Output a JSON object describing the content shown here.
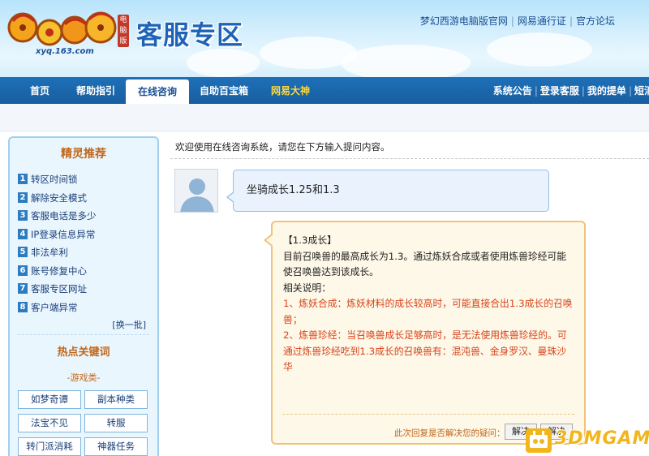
{
  "header": {
    "logo_url": "xyq.163.com",
    "logo_badge": "电脑版",
    "zone_title": "客服专区",
    "top_links": [
      "梦幻西游电脑版官网",
      "网易通行证",
      "官方论坛"
    ]
  },
  "nav": {
    "items": [
      "首页",
      "帮助指引",
      "在线咨询",
      "自助百宝箱",
      "网易大神"
    ],
    "active_index": 2,
    "right_links": [
      "系统公告",
      "登录客服",
      "我的提单",
      "短消"
    ]
  },
  "sidebar": {
    "title": "精灵推荐",
    "items": [
      "转区时间锁",
      "解除安全模式",
      "客服电话是多少",
      "IP登录信息异常",
      "非法牟利",
      "账号修复中心",
      "客服专区网址",
      "客户端异常"
    ],
    "refresh_label": "[换一批]",
    "hot_title": "热点关键词",
    "category": "-游戏类-",
    "keywords": [
      "如梦奇谭",
      "副本种类",
      "法宝不见",
      "转服",
      "转门派消耗",
      "神器任务"
    ]
  },
  "chat": {
    "welcome": "欢迎使用在线咨询系统，请您在下方输入提问内容。",
    "user_message": "坐骑成长1.25和1.3",
    "answer": {
      "heading": "【1.3成长】",
      "line1": "目前召唤兽的最高成长为1.3。通过炼妖合成或者使用炼兽珍经可能使召唤兽达到该成长。",
      "note_label": "相关说明：",
      "point1": "1、炼妖合成：炼妖材料的成长较高时，可能直接合出1.3成长的召唤兽；",
      "point2": "2、炼兽珍经：当召唤兽成长足够高时，是无法使用炼兽珍经的。可通过炼兽珍经吃到1.3成长的召唤兽有：混沌兽、金身罗汉、曼珠沙华"
    },
    "resolved_question": "此次回复是否解决您的疑问：",
    "resolved_label": "解决",
    "unresolved_label": "解决"
  },
  "watermark": "3DMGAME",
  "colors": {
    "nav_blue": "#1f70b8",
    "accent_orange": "#c0661a",
    "answer_red": "#d9431a",
    "answer_border": "#f0c27a",
    "bubble_blue": "#eaf3fd"
  }
}
